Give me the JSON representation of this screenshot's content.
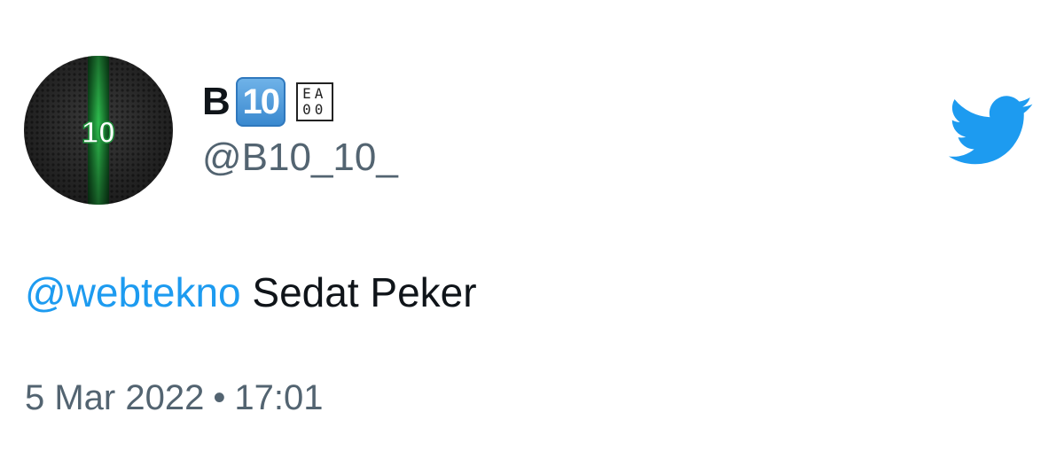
{
  "user": {
    "display_name": "B",
    "keycap_text": "10",
    "badge_top": "EA",
    "badge_bottom": "00",
    "handle": "@B10_10_",
    "avatar_text": "10",
    "avatar_icon": "avatar-10-jersey"
  },
  "tweet": {
    "mention": "@webtekno",
    "body": " Sedat Peker",
    "date": "5 Mar 2022",
    "separator": "•",
    "time": "17:01"
  },
  "brand": {
    "logo": "twitter-bird-icon",
    "color": "#1d9bf0"
  },
  "colors": {
    "text": "#0f1419",
    "secondary": "#536471",
    "link": "#1d9bf0"
  }
}
